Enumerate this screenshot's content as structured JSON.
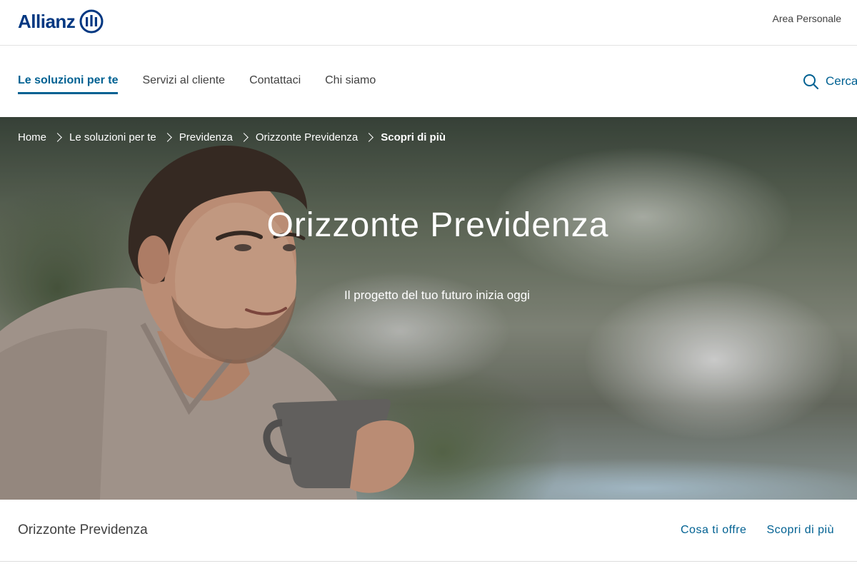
{
  "header": {
    "logo_text": "Allianz",
    "area_personale": "Area Personale"
  },
  "nav": {
    "items": [
      {
        "label": "Le soluzioni per te",
        "active": true
      },
      {
        "label": "Servizi al cliente",
        "active": false
      },
      {
        "label": "Contattaci",
        "active": false
      },
      {
        "label": "Chi siamo",
        "active": false
      }
    ],
    "search_label": "Cerca"
  },
  "breadcrumb": {
    "items": [
      "Home",
      "Le soluzioni per te",
      "Previdenza",
      "Orizzonte Previdenza",
      "Scopri di più"
    ]
  },
  "hero": {
    "title": "Orizzonte Previdenza",
    "subtitle": "Il progetto del tuo futuro inizia oggi"
  },
  "subnav": {
    "title": "Orizzonte Previdenza",
    "links": [
      "Cosa ti offre",
      "Scopri di più"
    ]
  },
  "colors": {
    "brand": "#003781",
    "accent": "#006192"
  }
}
